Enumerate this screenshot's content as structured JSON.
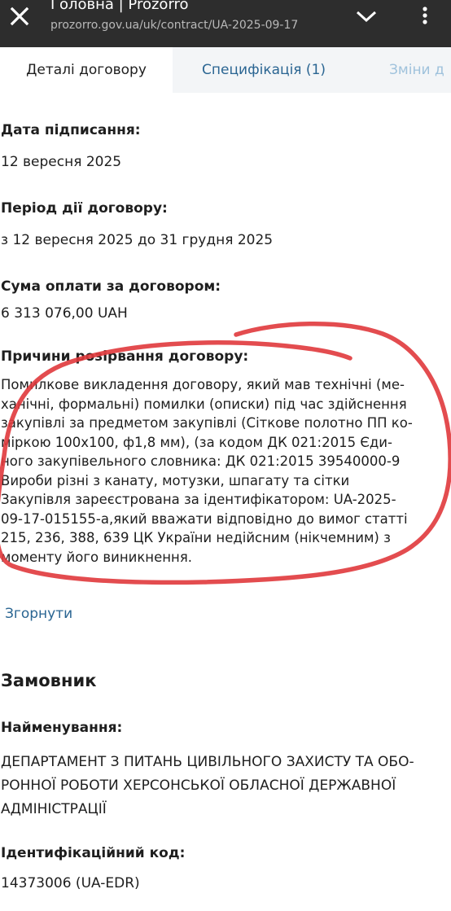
{
  "browser": {
    "title": "Головна | Prozorro",
    "url": "prozorro.gov.ua/uk/contract/UA-2025-09-17"
  },
  "tabs": [
    {
      "label": "Деталі договору"
    },
    {
      "label": "Специфікація (1)"
    },
    {
      "label": "Зміни д"
    }
  ],
  "details": {
    "signing_date_label": "Дата підписання:",
    "signing_date_value": "12 вересня 2025",
    "period_label": "Період дії договору:",
    "period_value": "з 12 вересня 2025 до 31 грудня 2025",
    "amount_label": "Сума оплати за договором:",
    "amount_value": "6 313 076,00 UAH",
    "termination_label": "Причини розірвання договору:",
    "termination_lines": [
      "Помилкове викладення договору, який мав технічні (ме-",
      "ханічні, формальні) помилки (описки) під час здійснення",
      "закупівлі за предметом закупівлі (Сіткове полотно ПП ко-",
      "міркою 100х100, ф1,8 мм), (за кодом ДК 021:2015 Єди-",
      "ного закупівельного словника: ДК 021:2015 39540000-9",
      "Вироби різні з канату, мотузки, шпагату та сітки",
      "Закупівля зареєстрована за ідентифікатором: UA-2025-",
      "09-17-015155-а,який вважати відповідно до вимог статті",
      "215, 236, 388, 639 ЦК України  недійсним (нікчемним) з",
      "моменту його виникнення."
    ],
    "collapse_label": "Згорнути"
  },
  "customer": {
    "section_title": "Замовник",
    "name_label": "Найменування:",
    "name_lines": [
      "ДЕПАРТАМЕНТ З ПИТАНЬ ЦИВІЛЬНОГО ЗАХИСТУ ТА ОБО-",
      "РОННОЇ РОБОТИ ХЕРСОНСЬКОЇ ОБЛАСНОЇ ДЕРЖАВНОЇ",
      "АДМІНІСТРАЦІЇ"
    ],
    "id_label": "Ідентифікаційний код:",
    "id_value": "14373006 (UA-EDR)"
  },
  "colors": {
    "topbar": "#2d2d2d",
    "link": "#2a6592",
    "annotation": "#e0393c"
  },
  "icons": {
    "close": "close-icon",
    "chevron": "chevron-down-icon",
    "more": "more-vert-icon"
  }
}
